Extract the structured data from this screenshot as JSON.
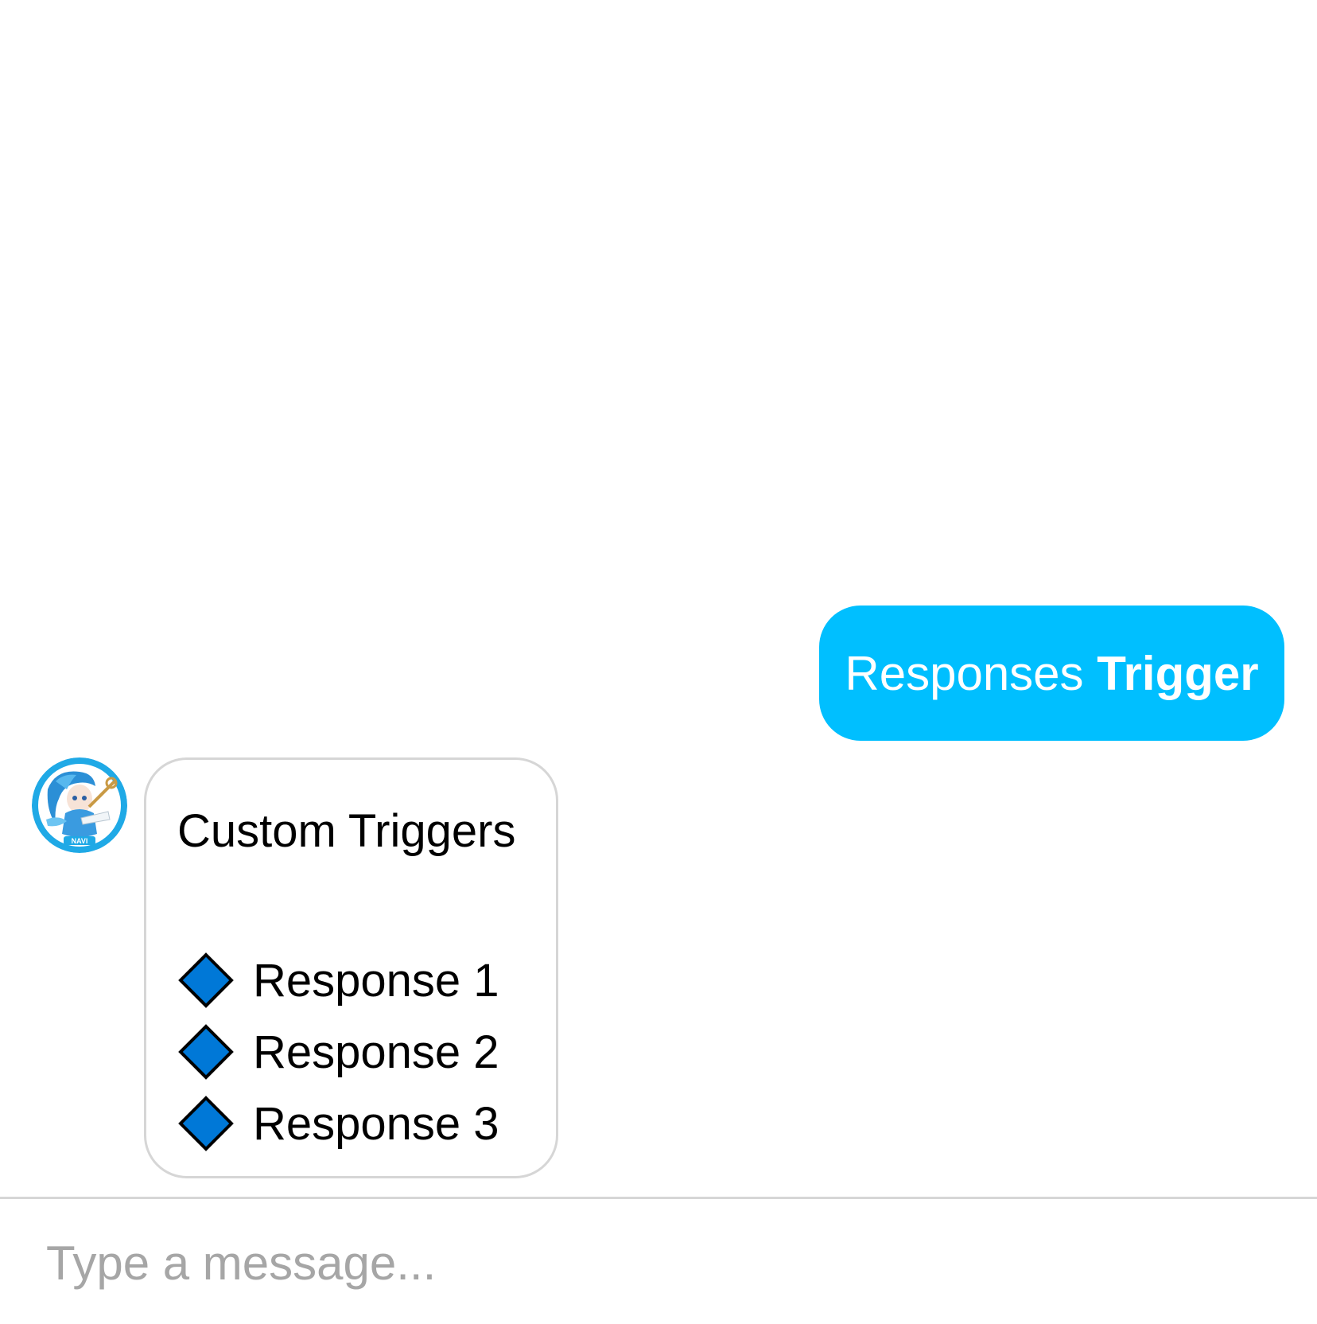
{
  "messages": {
    "user": {
      "text": "Responses",
      "emphasis": "Trigger",
      "bubble_color": "#00bfff"
    },
    "bot": {
      "avatar_label": "NAVI",
      "avatar_icon": "navi-avatar-icon",
      "title": "Custom Triggers",
      "responses": [
        {
          "icon": "blue-diamond-icon",
          "label": "Response 1"
        },
        {
          "icon": "blue-diamond-icon",
          "label": "Response 2"
        },
        {
          "icon": "blue-diamond-icon",
          "label": "Response 3"
        }
      ],
      "diamond_color": "#0078d7"
    }
  },
  "composer": {
    "placeholder": "Type a message..."
  }
}
